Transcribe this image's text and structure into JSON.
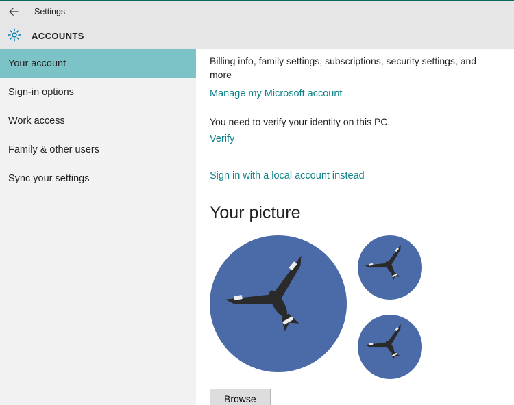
{
  "window": {
    "title": "Settings"
  },
  "header": {
    "section": "ACCOUNTS"
  },
  "sidebar": {
    "items": [
      {
        "label": "Your account",
        "active": true
      },
      {
        "label": "Sign-in options",
        "active": false
      },
      {
        "label": "Work access",
        "active": false
      },
      {
        "label": "Family & other users",
        "active": false
      },
      {
        "label": "Sync your settings",
        "active": false
      }
    ]
  },
  "content": {
    "billing_info": "Billing info, family settings, subscriptions, security settings, and more",
    "manage_link": "Manage my Microsoft account",
    "verify_prompt": "You need to verify your identity on this PC.",
    "verify_link": "Verify",
    "local_account_link": "Sign in with a local account instead",
    "picture_heading": "Your picture",
    "browse_button": "Browse"
  }
}
